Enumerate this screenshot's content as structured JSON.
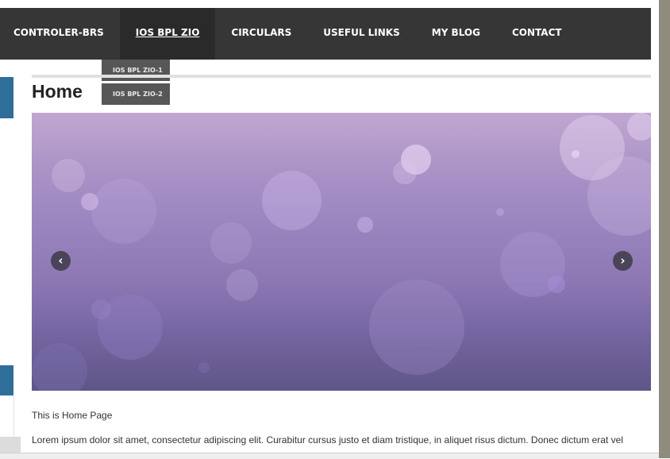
{
  "nav": {
    "items": [
      {
        "label": "CONTROLER-BRS"
      },
      {
        "label": "IOS BPL ZIO"
      },
      {
        "label": "CIRCULARS"
      },
      {
        "label": "USEFUL LINKS"
      },
      {
        "label": "MY BLOG"
      },
      {
        "label": "CONTACT"
      }
    ],
    "active_item": "IOS BPL ZIO",
    "dropdown": [
      {
        "label": "IOS BPL ZIO-1"
      },
      {
        "label": "IOS BPL ZIO-2"
      }
    ]
  },
  "page": {
    "title": "Home",
    "intro": "This is Home Page",
    "body": "Lorem ipsum dolor sit amet, consectetur adipiscing elit. Curabitur cursus justo et diam tristique, in aliquet risus dictum. Donec dictum erat vel"
  },
  "slider": {
    "prev_icon": "chevron-left-icon",
    "next_icon": "chevron-right-icon"
  },
  "colors": {
    "navbar": "#363636",
    "dropdown": "#575757",
    "side_tab": "#2f6e99",
    "slide_top": "#c0a7d0",
    "slide_bottom": "#5f5587"
  }
}
